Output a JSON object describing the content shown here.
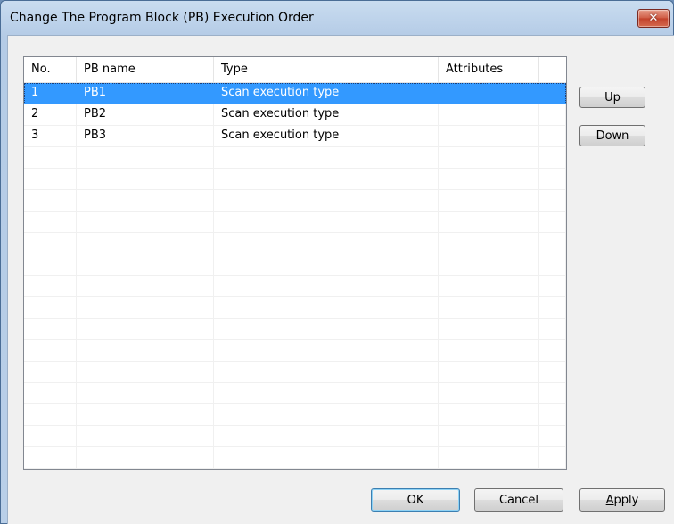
{
  "window": {
    "title": "Change The Program Block (PB) Execution Order",
    "close_glyph": "✕"
  },
  "list": {
    "columns": [
      "No.",
      "PB name",
      "Type",
      "Attributes",
      ""
    ],
    "rows": [
      {
        "no": "1",
        "pb_name": "PB1",
        "type": "Scan execution type",
        "attributes": "",
        "selected": true
      },
      {
        "no": "2",
        "pb_name": "PB2",
        "type": "Scan execution type",
        "attributes": "",
        "selected": false
      },
      {
        "no": "3",
        "pb_name": "PB3",
        "type": "Scan execution type",
        "attributes": "",
        "selected": false
      }
    ],
    "empty_rows": 16
  },
  "side_buttons": {
    "up": "Up",
    "down": "Down"
  },
  "footer_buttons": {
    "ok": "OK",
    "cancel": "Cancel",
    "apply_mnemonic": "A",
    "apply_rest": "pply"
  },
  "colors": {
    "selection": "#3399ff",
    "close_button": "#c2412b"
  }
}
